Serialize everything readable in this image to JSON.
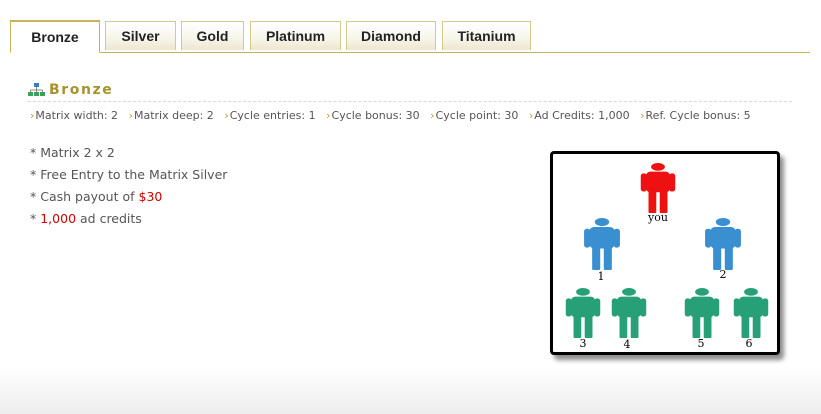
{
  "tabs": [
    {
      "label": "Bronze",
      "active": true
    },
    {
      "label": "Silver",
      "active": false
    },
    {
      "label": "Gold",
      "active": false
    },
    {
      "label": "Platinum",
      "active": false
    },
    {
      "label": "Diamond",
      "active": false
    },
    {
      "label": "Titanium",
      "active": false
    }
  ],
  "section": {
    "title": "Bronze",
    "icon": "org-chart-icon"
  },
  "stats": [
    "Matrix width: 2",
    "Matrix deep: 2",
    "Cycle entries: 1",
    "Cycle bonus: 30",
    "Cycle point: 30",
    "Ad Credits: 1,000",
    "Ref. Cycle bonus: 5"
  ],
  "features": {
    "bullet": "*",
    "line1": "Matrix 2 x 2",
    "line2": "Free Entry to the Matrix Silver",
    "line3_prefix": "Cash payout of ",
    "line3_value": "$30",
    "line4_value": "1,000",
    "line4_suffix": " ad credits"
  },
  "matrix_diagram": {
    "top_label": "you",
    "level1": [
      "1",
      "2"
    ],
    "level2": [
      "3",
      "4",
      "5",
      "6"
    ],
    "colors": {
      "you": "#ee1111",
      "level1": "#3a8fd0",
      "level2": "#27a077"
    }
  },
  "colors": {
    "accent": "#a8922e",
    "tab_border": "#c8b35a",
    "highlight": "#cc0000"
  }
}
